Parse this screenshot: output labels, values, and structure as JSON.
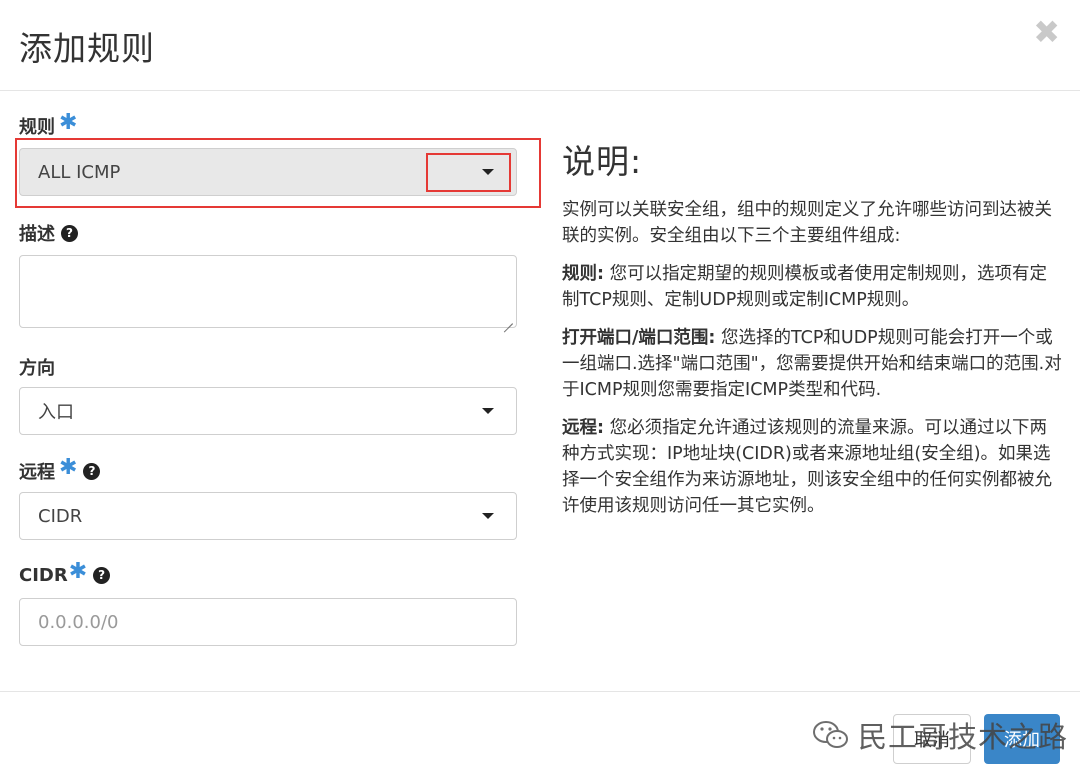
{
  "header": {
    "title": "添加规则",
    "close_glyph": "✖"
  },
  "form": {
    "rule": {
      "label": "规则",
      "required": "✱",
      "value": "ALL ICMP"
    },
    "description": {
      "label": "描述",
      "help": "?"
    },
    "direction": {
      "label": "方向",
      "value": "入口"
    },
    "remote": {
      "label": "远程",
      "required": "✱",
      "help": "?",
      "value": "CIDR"
    },
    "cidr": {
      "label": "CIDR",
      "required": "✱",
      "help": "?",
      "placeholder": "0.0.0.0/0"
    }
  },
  "explanation": {
    "title": "说明:",
    "intro": "实例可以关联安全组，组中的规则定义了允许哪些访问到达被关联的实例。安全组由以下三个主要组件组成:",
    "items": [
      {
        "term": "规则:",
        "text": " 您可以指定期望的规则模板或者使用定制规则，选项有定制TCP规则、定制UDP规则或定制ICMP规则。"
      },
      {
        "term": "打开端口/端口范围:",
        "text": " 您选择的TCP和UDP规则可能会打开一个或一组端口.选择\"端口范围\"，您需要提供开始和结束端口的范围.对于ICMP规则您需要指定ICMP类型和代码."
      },
      {
        "term": "远程:",
        "text": " 您必须指定允许通过该规则的流量来源。可以通过以下两种方式实现：IP地址块(CIDR)或者来源地址组(安全组)。如果选择一个安全组作为来访源地址，则该安全组中的任何实例都被允许使用该规则访问任一其它实例。"
      }
    ]
  },
  "footer": {
    "cancel_label": "取消",
    "add_label": "添加"
  },
  "watermark": {
    "text": "民工哥技术之路",
    "icon": "wechat-icon"
  },
  "colors": {
    "accent": "#3a86c8",
    "required": "#3b8ed8",
    "highlight": "#e53935"
  }
}
